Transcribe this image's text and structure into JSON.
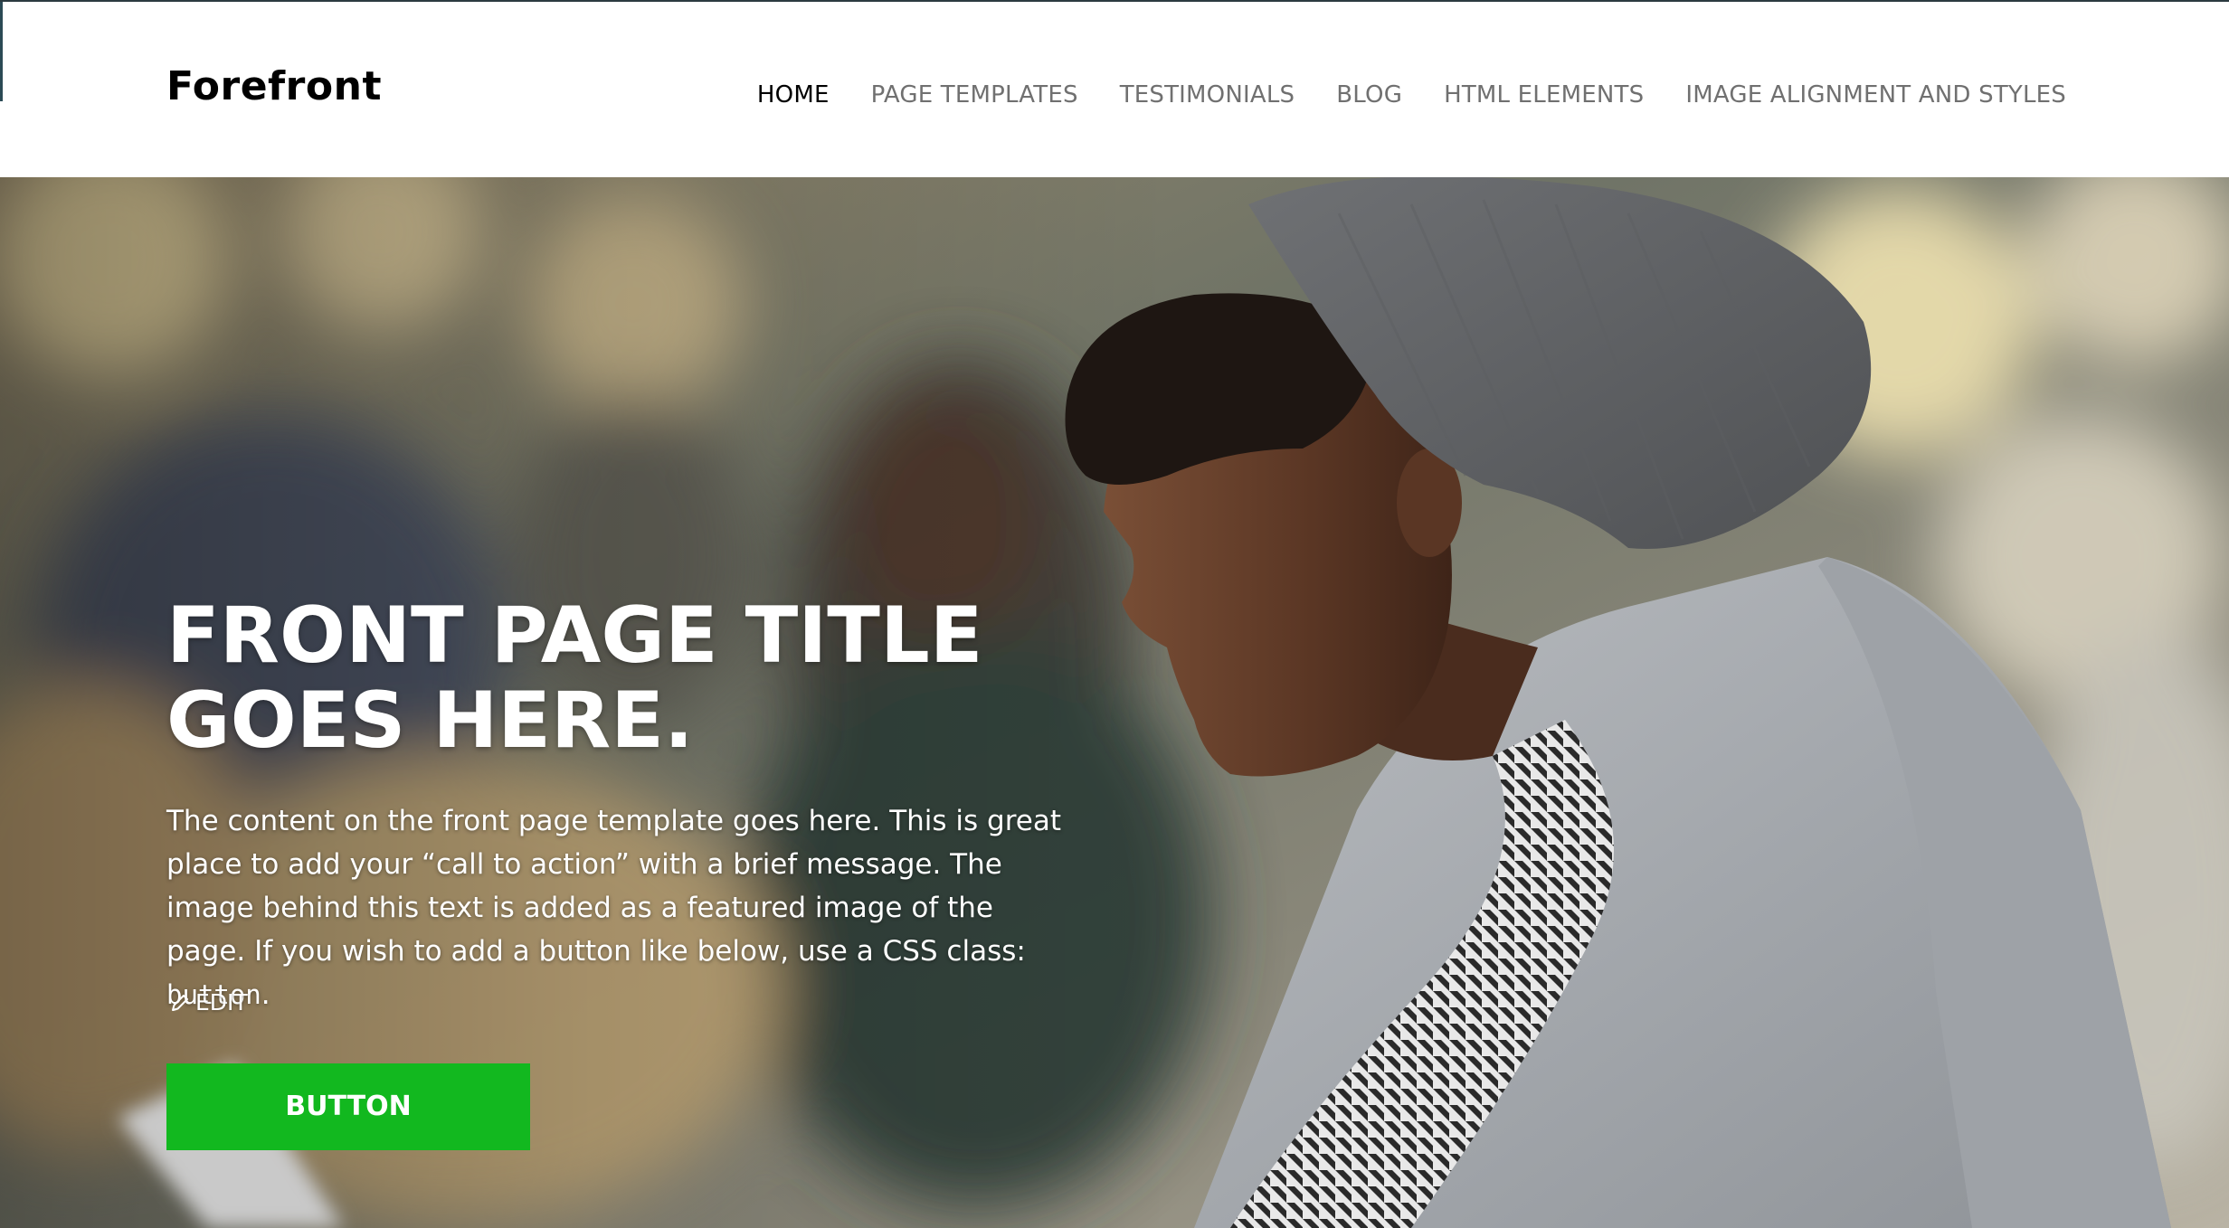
{
  "site": {
    "title": "Forefront"
  },
  "nav": {
    "items": [
      {
        "label": "HOME",
        "active": true
      },
      {
        "label": "PAGE TEMPLATES",
        "active": false
      },
      {
        "label": "TESTIMONIALS",
        "active": false
      },
      {
        "label": "BLOG",
        "active": false
      },
      {
        "label": "HTML ELEMENTS",
        "active": false
      },
      {
        "label": "IMAGE ALIGNMENT AND STYLES",
        "active": false
      }
    ]
  },
  "hero": {
    "title": "FRONT PAGE TITLE\nGOES HERE.",
    "text_main": "The content on the front page template goes here. This is great place to add your “call to action” with a brief message. The image behind this text is added as a featured image of the page. If you wish to add a button like below, use a CSS class: ",
    "text_code": "button",
    "text_end": ".",
    "button_label": "BUTTON",
    "edit_label": "EDIT"
  },
  "colors": {
    "button": "#12b81f",
    "nav_active": "#000000",
    "nav_inactive": "#707070"
  },
  "icons": {
    "edit": "pencil-icon"
  }
}
